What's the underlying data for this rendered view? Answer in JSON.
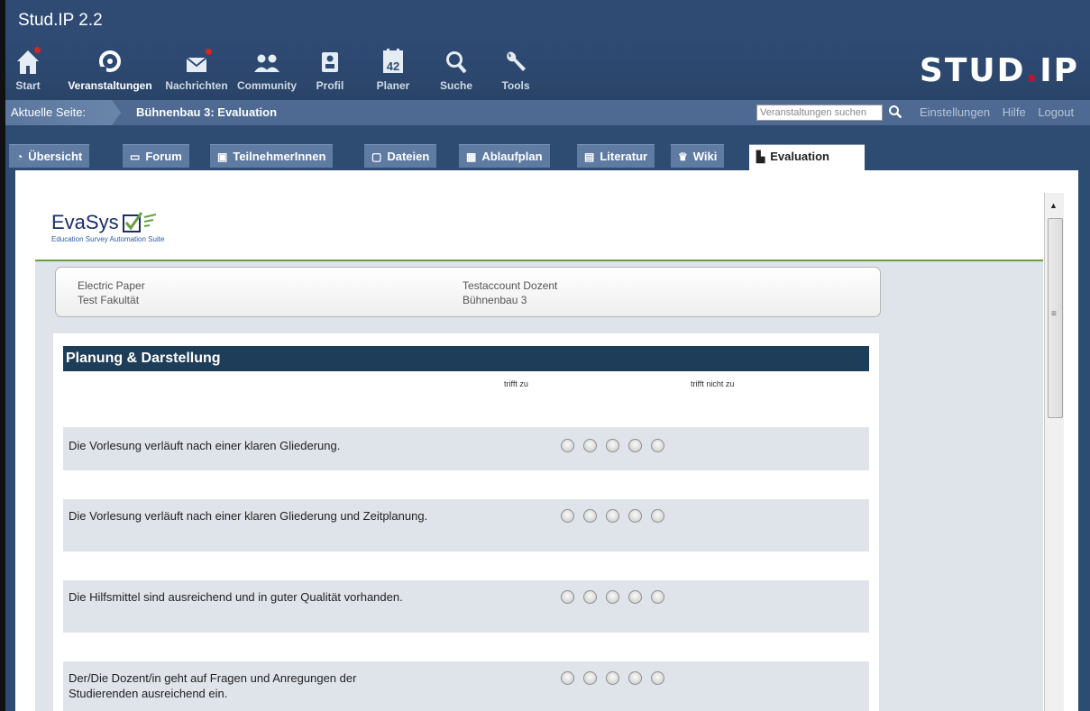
{
  "app": {
    "title": "Stud.IP 2.2",
    "logo_main": "STUD",
    "logo_dot": ".",
    "logo_ip": "IP"
  },
  "nav": [
    {
      "label": "Start",
      "icon": "home-icon",
      "badge": true
    },
    {
      "label": "Veranstaltungen",
      "icon": "seminar-icon",
      "badge": false,
      "active": true
    },
    {
      "label": "Nachrichten",
      "icon": "mail-icon",
      "badge": true
    },
    {
      "label": "Community",
      "icon": "community-icon",
      "badge": false
    },
    {
      "label": "Profil",
      "icon": "profile-icon",
      "badge": false
    },
    {
      "label": "Planer",
      "icon": "calendar-icon",
      "badge": false,
      "date": "42"
    },
    {
      "label": "Suche",
      "icon": "search-icon",
      "badge": false
    },
    {
      "label": "Tools",
      "icon": "wrench-icon",
      "badge": false
    }
  ],
  "breadcrumb": {
    "label": "Aktuelle Seite:",
    "current": "Bühnenbau 3: Evaluation"
  },
  "search": {
    "placeholder": "Veranstaltungen suchen"
  },
  "top_links": {
    "settings": "Einstellungen",
    "help": "Hilfe",
    "logout": "Logout"
  },
  "tabs": [
    {
      "label": "Übersicht",
      "icon": "overview-icon"
    },
    {
      "label": "Forum",
      "icon": "forum-icon"
    },
    {
      "label": "TeilnehmerInnen",
      "icon": "participants-icon"
    },
    {
      "label": "Dateien",
      "icon": "files-icon"
    },
    {
      "label": "Ablaufplan",
      "icon": "schedule-icon"
    },
    {
      "label": "Literatur",
      "icon": "literature-icon"
    },
    {
      "label": "Wiki",
      "icon": "wiki-icon"
    },
    {
      "label": "Evaluation",
      "icon": "evaluation-icon",
      "active": true
    }
  ],
  "evasys": {
    "logo_text": "EvaSys",
    "logo_sub": "Education Survey Automation Suite",
    "info": {
      "left1": "Electric Paper",
      "left2": "Test Fakultät",
      "right1": "Testaccount Dozent",
      "right2": "Bühnenbau 3"
    },
    "section_title": "Planung & Darstellung",
    "scale_low": "trifft zu",
    "scale_high": "trifft nicht zu",
    "questions": [
      {
        "text": "Die Vorlesung verläuft nach einer klaren Gliederung."
      },
      {
        "text": "Die Vorlesung verläuft nach einer klaren Gliederung und Zeitplanung."
      },
      {
        "text": "Die Hilfsmittel sind ausreichend und in guter Qualität vorhanden."
      },
      {
        "text": "Der/Die Dozent/in geht auf Fragen und Anregungen der Studierenden ausreichend ein."
      }
    ]
  },
  "colors": {
    "header": "#2f4b74",
    "accent_red": "#c8102e",
    "section_head": "#1e3d58",
    "evasys_green": "#6a9f43"
  }
}
